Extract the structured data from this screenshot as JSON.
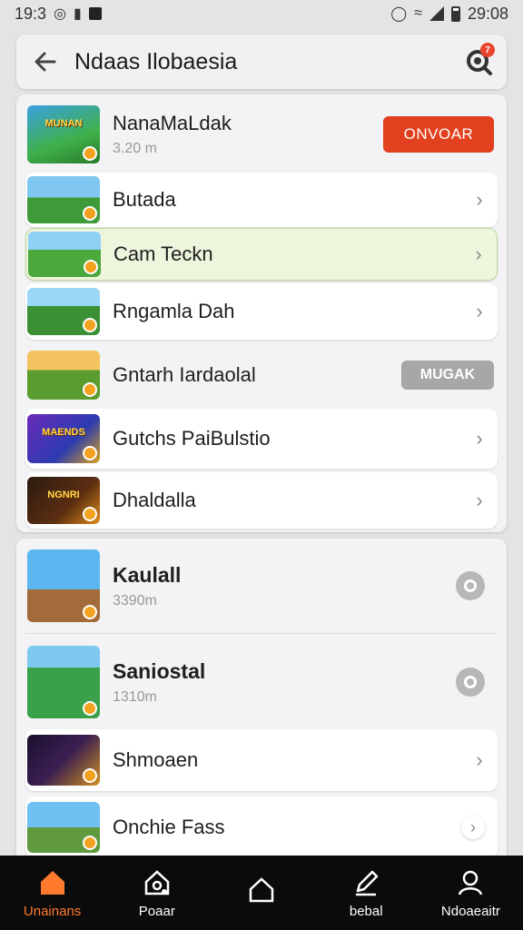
{
  "status": {
    "time_left": "19:3",
    "time_right": "29:08"
  },
  "header": {
    "title": "Ndaas Ilobaesia",
    "badge": "7"
  },
  "list1": [
    {
      "title": "NanaMaLdak",
      "sub": "3.20 m",
      "action": "ONVOAR",
      "thumb_text": "MUNAN"
    },
    {
      "title": "Butada"
    },
    {
      "title": "Cam Teckn"
    },
    {
      "title": "Rngamla Dah"
    },
    {
      "title": "Gntarh Iardaolal",
      "action": "MUGAK"
    },
    {
      "title": "Gutchs PaiBulstio",
      "thumb_text": "MAENDS"
    },
    {
      "title": "Dhaldalla",
      "thumb_text": "NGNRI"
    }
  ],
  "list2": [
    {
      "title": "Kaulall",
      "sub": "3390m"
    },
    {
      "title": "Saniostal",
      "sub": "1310m"
    },
    {
      "title": "Shmoaen"
    },
    {
      "title": "Onchie Fass"
    }
  ],
  "nav": [
    {
      "label": "Unainans"
    },
    {
      "label": "Poaar"
    },
    {
      "label": ""
    },
    {
      "label": "bebal"
    },
    {
      "label": "Ndoaeaitr"
    }
  ],
  "colors": {
    "accent": "#e2411f",
    "nav_active": "#ff7a2d",
    "highlight": "#eef5dd"
  }
}
